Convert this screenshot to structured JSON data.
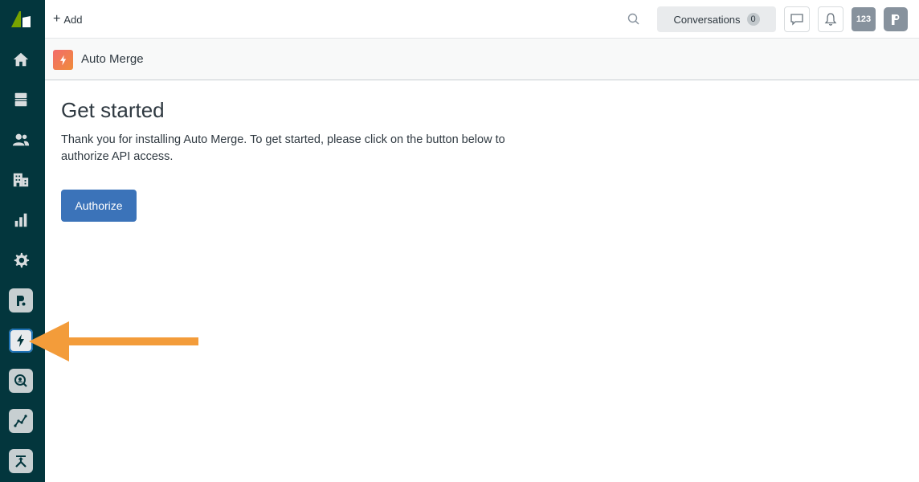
{
  "sidebar": {
    "items": [
      {
        "name": "home",
        "icon": "home-icon"
      },
      {
        "name": "views",
        "icon": "views-icon"
      },
      {
        "name": "customers",
        "icon": "customers-icon"
      },
      {
        "name": "organizations",
        "icon": "building-icon"
      },
      {
        "name": "reporting",
        "icon": "bar-chart-icon"
      },
      {
        "name": "admin",
        "icon": "gear-icon"
      }
    ],
    "apps": [
      {
        "name": "app-p",
        "icon": "p-app-icon"
      },
      {
        "name": "auto-merge",
        "icon": "lightning-icon",
        "active": true
      },
      {
        "name": "search-app",
        "icon": "user-search-icon"
      },
      {
        "name": "analytics-app",
        "icon": "line-graph-icon"
      },
      {
        "name": "merge-app",
        "icon": "merge-icon"
      }
    ]
  },
  "topbar": {
    "add_label": "Add",
    "conversations_label": "Conversations",
    "conversations_count": "0",
    "badge_label": "123"
  },
  "appbar": {
    "title": "Auto Merge"
  },
  "main": {
    "title": "Get started",
    "description": "Thank you for installing Auto Merge. To get started, please click on the button below to authorize API access.",
    "authorize_label": "Authorize"
  },
  "colors": {
    "sidebar_bg": "#03363d",
    "primary_button": "#3b73b9",
    "annotation_arrow": "#f39c3a",
    "app_logo_start": "#f26b6b",
    "app_logo_end": "#f08c3a"
  }
}
